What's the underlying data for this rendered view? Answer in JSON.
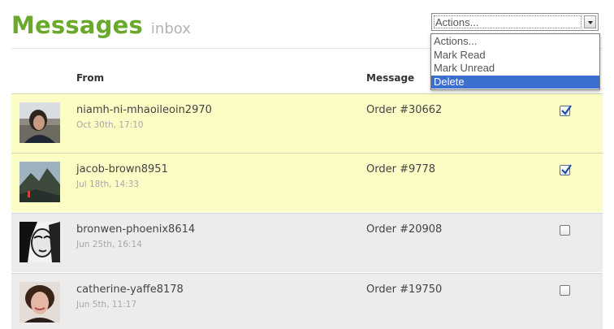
{
  "header": {
    "title": "Messages",
    "subtitle": "inbox"
  },
  "actions": {
    "selected": "Actions...",
    "options": [
      "Actions...",
      "Mark Read",
      "Mark Unread",
      "Delete"
    ],
    "highlighted": "Delete"
  },
  "table": {
    "columns": {
      "from": "From",
      "message": "Message"
    },
    "rows": [
      {
        "sender": "niamh-ni-mhaoileoin2970",
        "date": "Oct 30th, 17:10",
        "message": "Order #30662",
        "checked": true,
        "unread": true
      },
      {
        "sender": "jacob-brown8951",
        "date": "Jul 18th, 14:33",
        "message": "Order #9778",
        "checked": true,
        "unread": true
      },
      {
        "sender": "bronwen-phoenix8614",
        "date": "Jun 25th, 16:14",
        "message": "Order #20908",
        "checked": false,
        "unread": false
      },
      {
        "sender": "catherine-yaffe8178",
        "date": "Jun 5th, 11:17",
        "message": "Order #19750",
        "checked": false,
        "unread": false
      }
    ]
  },
  "colors": {
    "title": "#6aaa2a",
    "unread_row": "#fcfcc5",
    "read_row": "#ececec",
    "highlight": "#3a6fd1"
  }
}
